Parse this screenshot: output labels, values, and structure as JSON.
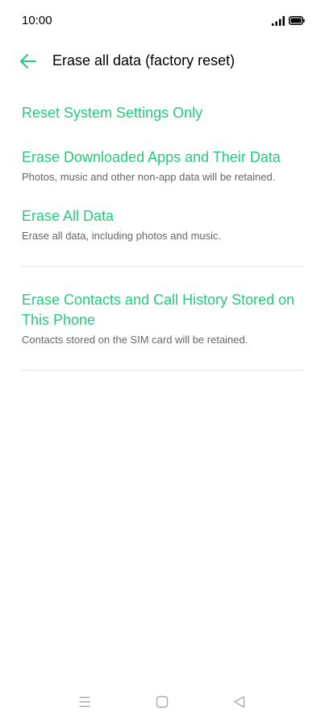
{
  "status_bar": {
    "time": "10:00",
    "signal_icon": "signal-icon",
    "battery_icon": "battery-icon"
  },
  "header": {
    "back_icon": "arrow-left-icon",
    "title": "Erase all data (factory reset)",
    "accent_color": "#27c97e"
  },
  "options": [
    {
      "label": "Reset System Settings Only",
      "description": ""
    },
    {
      "label": "Erase Downloaded Apps and Their Data",
      "description": "Photos, music and other non-app data will be retained."
    },
    {
      "label": "Erase All Data",
      "description": "Erase all data, including photos and music."
    },
    {
      "label": "Erase Contacts and Call History Stored on This Phone",
      "description": "Contacts stored on the SIM card will be retained."
    }
  ],
  "nav_bar": {
    "menu_icon": "menu-icon",
    "home_icon": "home-square-icon",
    "back_icon": "back-triangle-icon"
  }
}
